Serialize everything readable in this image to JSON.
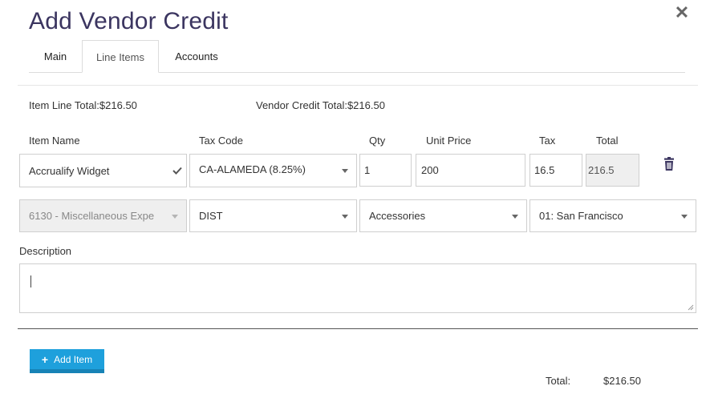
{
  "dialog": {
    "title": "Add Vendor Credit",
    "close_glyph": "✕"
  },
  "tabs": [
    {
      "label": "Main"
    },
    {
      "label": "Line Items"
    },
    {
      "label": "Accounts"
    }
  ],
  "active_tab": "Line Items",
  "summary": {
    "item_line_total": "Item Line Total:$216.50",
    "vendor_credit_total": "Vendor Credit Total:$216.50"
  },
  "columns": {
    "item_name": "Item Name",
    "tax_code": "Tax Code",
    "qty": "Qty",
    "unit_price": "Unit Price",
    "tax": "Tax",
    "total": "Total"
  },
  "line_item": {
    "item_name": "Accrualify Widget",
    "tax_code": "CA-ALAMEDA (8.25%)",
    "qty": "1",
    "unit_price": "200",
    "tax": "16.5",
    "total": "216.5",
    "account": "6130 - Miscellaneous Expe",
    "department": "DIST",
    "category": "Accessories",
    "location": "01: San Francisco"
  },
  "description": {
    "label": "Description",
    "value": ""
  },
  "add_item_label": "Add Item",
  "footer": {
    "total_label": "Total:",
    "total_value": "$216.50"
  },
  "colors": {
    "title": "#3b3560",
    "button": "#1ea0dc",
    "trash": "#3b3560",
    "check": "#555555"
  },
  "icons": {
    "close": "close-icon",
    "check": "check-icon",
    "trash": "trash-icon",
    "plus": "plus-icon",
    "caret": "chevron-down-icon"
  }
}
